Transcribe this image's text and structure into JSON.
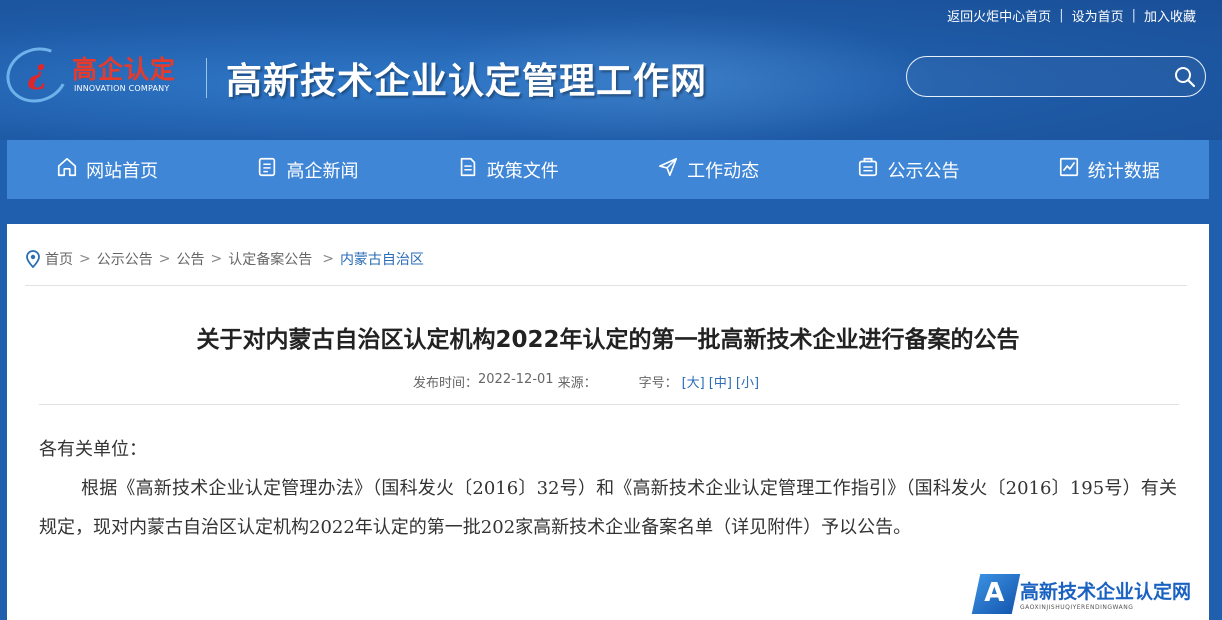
{
  "top_links": [
    "返回火炬中心首页",
    "设为首页",
    "加入收藏"
  ],
  "logo": {
    "cn": "高企认定",
    "en": "INNOVATION COMPANY"
  },
  "site_title": "高新技术企业认定管理工作网",
  "search": {
    "placeholder": ""
  },
  "nav": [
    {
      "label": "网站首页",
      "icon": "home-icon"
    },
    {
      "label": "高企新闻",
      "icon": "news-icon"
    },
    {
      "label": "政策文件",
      "icon": "document-icon"
    },
    {
      "label": "工作动态",
      "icon": "send-icon"
    },
    {
      "label": "公示公告",
      "icon": "bulletin-icon"
    },
    {
      "label": "统计数据",
      "icon": "chart-icon"
    }
  ],
  "breadcrumb": {
    "items": [
      "首页",
      "公示公告",
      "公告",
      "认定备案公告"
    ],
    "current": "内蒙古自治区"
  },
  "article": {
    "title": "关于对内蒙古自治区认定机构2022年认定的第一批高新技术企业进行备案的公告",
    "publish_label": "发布时间：",
    "publish_date": "2022-12-01",
    "source_label": "来源：",
    "font_label": "字号：",
    "font_sizes": [
      "[大]",
      "[中]",
      "[小]"
    ],
    "greeting": "各有关单位：",
    "paragraph": "根据《高新技术企业认定管理办法》（国科发火〔2016〕32号）和《高新技术企业认定管理工作指引》（国科发火〔2016〕195号）有关规定，现对内蒙古自治区认定机构2022年认定的第一批202家高新技术企业备案名单（详见附件）予以公告。"
  },
  "watermark": {
    "letter": "A",
    "title": "高新技术企业认定网",
    "pinyin": "GAOXINJISHUQIYERENDINGWANG"
  }
}
